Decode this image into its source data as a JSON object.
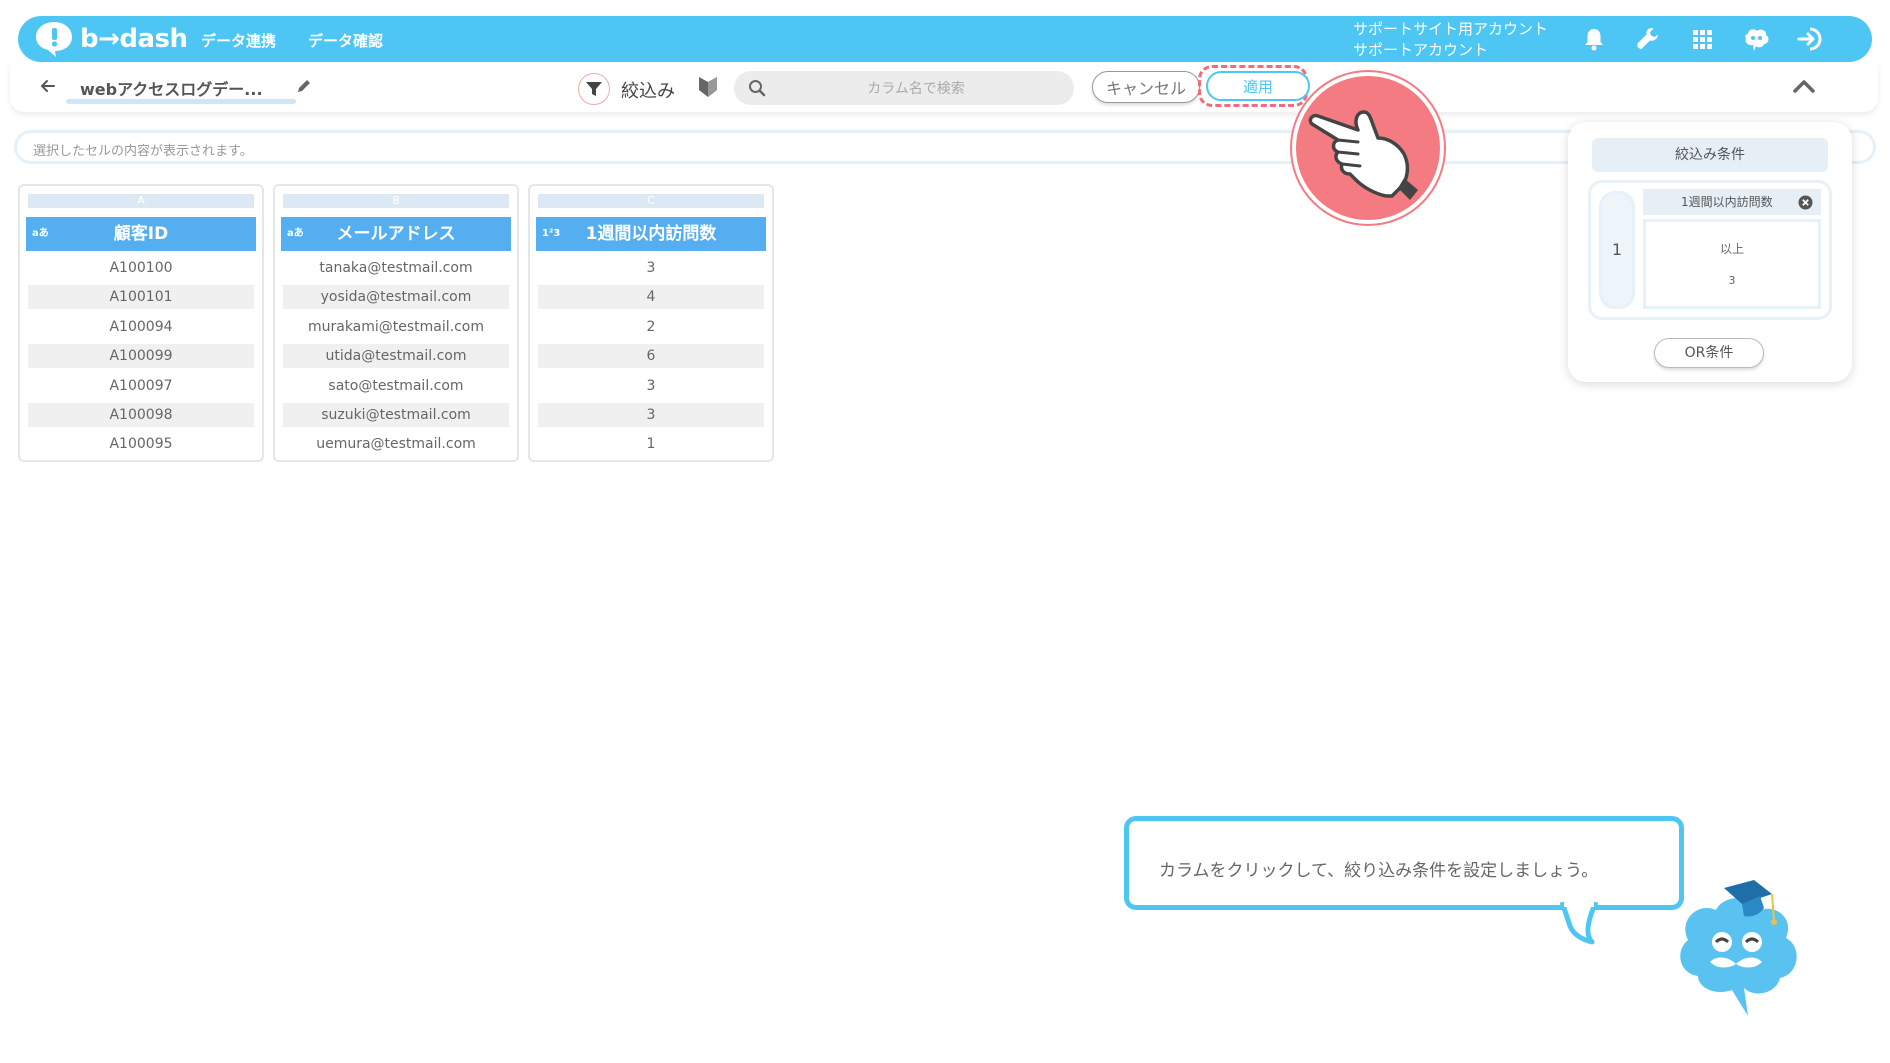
{
  "header": {
    "logo_text": "b→dash",
    "nav": [
      "データ連携",
      "データ確認"
    ],
    "account_line1": "サポートサイト用アカウント",
    "account_line2": "サポートアカウント",
    "icons": [
      "bell-icon",
      "wrench-icon",
      "grid-icon",
      "mascot-icon",
      "logout-icon"
    ]
  },
  "toolbar": {
    "doc_title": "webアクセスログデー...",
    "filter_label": "絞込み",
    "search_placeholder": "カラム名で検索",
    "cancel_label": "キャンセル",
    "apply_label": "適用"
  },
  "cell_bar": {
    "text": "選択したセルの内容が表示されます。"
  },
  "table": {
    "columns": [
      {
        "letter": "A",
        "type_badge": "aあ",
        "header": "顧客ID",
        "cells": [
          "A100100",
          "A100101",
          "A100094",
          "A100099",
          "A100097",
          "A100098",
          "A100095"
        ]
      },
      {
        "letter": "B",
        "type_badge": "aあ",
        "header": "メールアドレス",
        "cells": [
          "tanaka@testmail.com",
          "yosida@testmail.com",
          "murakami@testmail.com",
          "utida@testmail.com",
          "sato@testmail.com",
          "suzuki@testmail.com",
          "uemura@testmail.com"
        ]
      },
      {
        "letter": "C",
        "type_badge": "1²3",
        "header": "1週間以内訪問数",
        "cells": [
          "3",
          "4",
          "2",
          "6",
          "3",
          "3",
          "1"
        ]
      }
    ]
  },
  "filter_panel": {
    "title": "絞込み条件",
    "group_number": "1",
    "condition": {
      "column": "1週間以内訪問数",
      "operator": "以上",
      "value": "3"
    },
    "or_label": "OR条件"
  },
  "tutorial": {
    "message": "カラムをクリックして、絞り込み条件を設定しましょう。"
  },
  "colors": {
    "brand": "#4dc6f4",
    "header_cell": "#54aef0",
    "highlight": "#f47b82"
  }
}
